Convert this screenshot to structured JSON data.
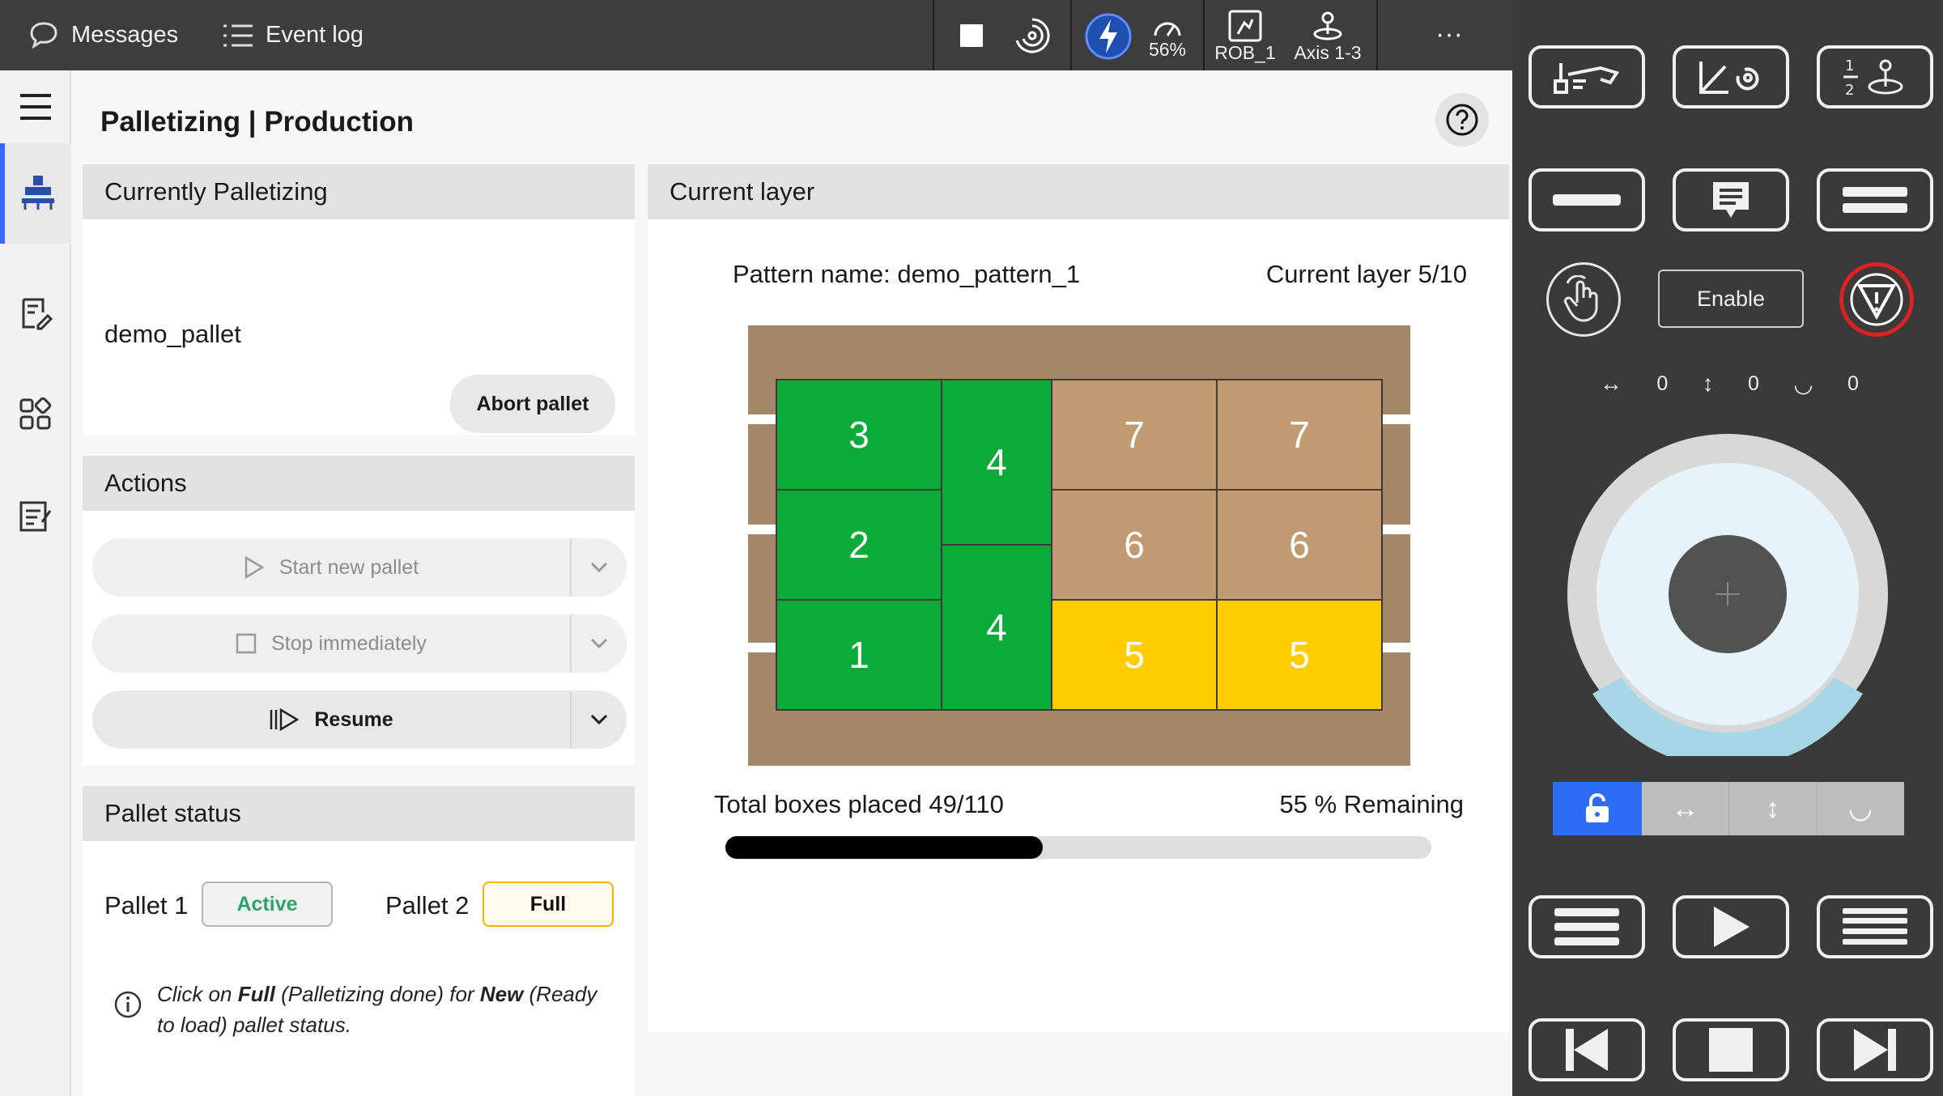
{
  "topbar": {
    "messages_label": "Messages",
    "eventlog_label": "Event log",
    "speed_value": "56%",
    "robot_label": "ROB_1",
    "axis_label": "Axis 1-3",
    "more_label": "···"
  },
  "nav": {
    "items": [
      "menu-icon",
      "palletizing-icon",
      "notes-icon",
      "apps-icon",
      "report-icon"
    ]
  },
  "page": {
    "title": "Palletizing | Production"
  },
  "currently_palletizing": {
    "header": "Currently Palletizing",
    "pallet_name": "demo_pallet",
    "abort_label": "Abort pallet"
  },
  "actions": {
    "header": "Actions",
    "start_label": "Start new pallet",
    "stop_label": "Stop immediately",
    "resume_label": "Resume"
  },
  "pallet_status": {
    "header": "Pallet status",
    "pallet1_label": "Pallet 1",
    "pallet1_status": "Active",
    "pallet2_label": "Pallet 2",
    "pallet2_status": "Full",
    "info_prefix": "Click on ",
    "info_full": "Full",
    "info_mid": " (Palletizing done) for ",
    "info_new": "New",
    "info_suffix": " (Ready to load) pallet status."
  },
  "current_layer": {
    "header": "Current layer",
    "pattern_name": "Pattern name: demo_pattern_1",
    "layer_text": "Current layer 5/10",
    "boxes_text": "Total boxes placed 49/110",
    "remaining_text": "55 % Remaining",
    "progress_fraction": 0.45,
    "boxes": [
      "3",
      "2",
      "1",
      "4",
      "4",
      "7",
      "7",
      "6",
      "6",
      "5",
      "5"
    ]
  },
  "colors": {
    "box_done": "#0aab38",
    "box_current": "#ffcc00",
    "box_pending": "#c09a70",
    "pallet": "#a5876a",
    "accent": "#3b66ff"
  },
  "right_panel": {
    "enable_label": "Enable",
    "jog_values": [
      "0",
      "0",
      "0"
    ]
  }
}
